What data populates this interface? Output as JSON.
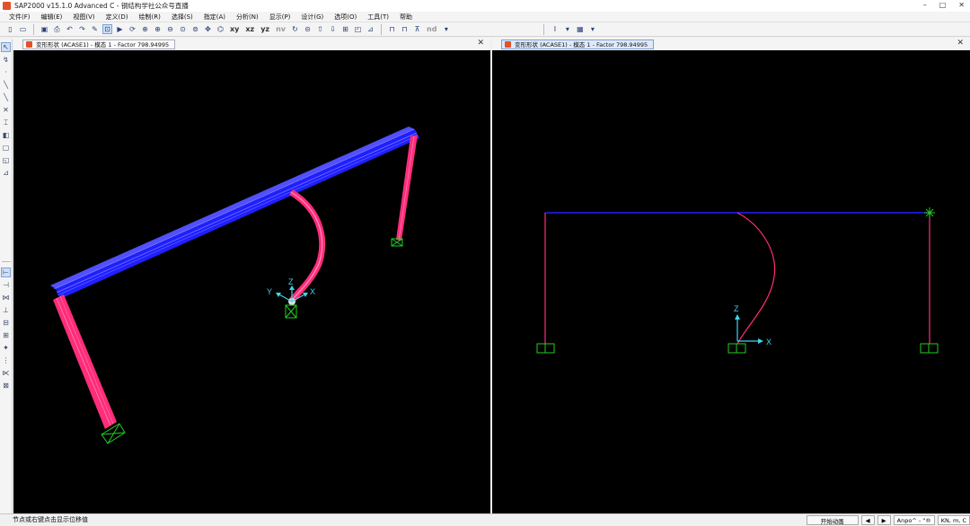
{
  "window": {
    "title": "SAP2000 v15.1.0 Advanced C - 钢结构学社公众号直播",
    "minimize": "–",
    "maximize": "□",
    "close": "✕"
  },
  "menu": [
    "文件(F)",
    "编辑(E)",
    "视图(V)",
    "定义(D)",
    "绘制(R)",
    "选择(S)",
    "指定(A)",
    "分析(N)",
    "显示(P)",
    "设计(G)",
    "选项(O)",
    "工具(T)",
    "帮助"
  ],
  "toolbar": {
    "xy": "xy",
    "xz": "xz",
    "yz": "yz",
    "nv": "nv",
    "nd": "nd"
  },
  "panes": [
    {
      "tab": "变形形状 (ACASE1) - 模态 1 - Factor 798.94995",
      "close": "✕",
      "axis_labels": {
        "z": "Z",
        "y": "Y",
        "x": "X"
      }
    },
    {
      "tab": "变形形状 (ACASE1) - 模态 1 - Factor 798.94995",
      "close": "✕",
      "axis_labels": {
        "z": "Z",
        "x": "X"
      }
    }
  ],
  "status": {
    "message": "节点或右键点击显示位移值",
    "animate_button": "开始动画",
    "coord_system": "Anpo^ - \"®",
    "units": "KN, m, C"
  },
  "colors": {
    "beam": "#1f1fff",
    "column": "#ff2d7a",
    "support": "#1fd01f",
    "axis": "#3fd4e8",
    "background": "#000000"
  }
}
